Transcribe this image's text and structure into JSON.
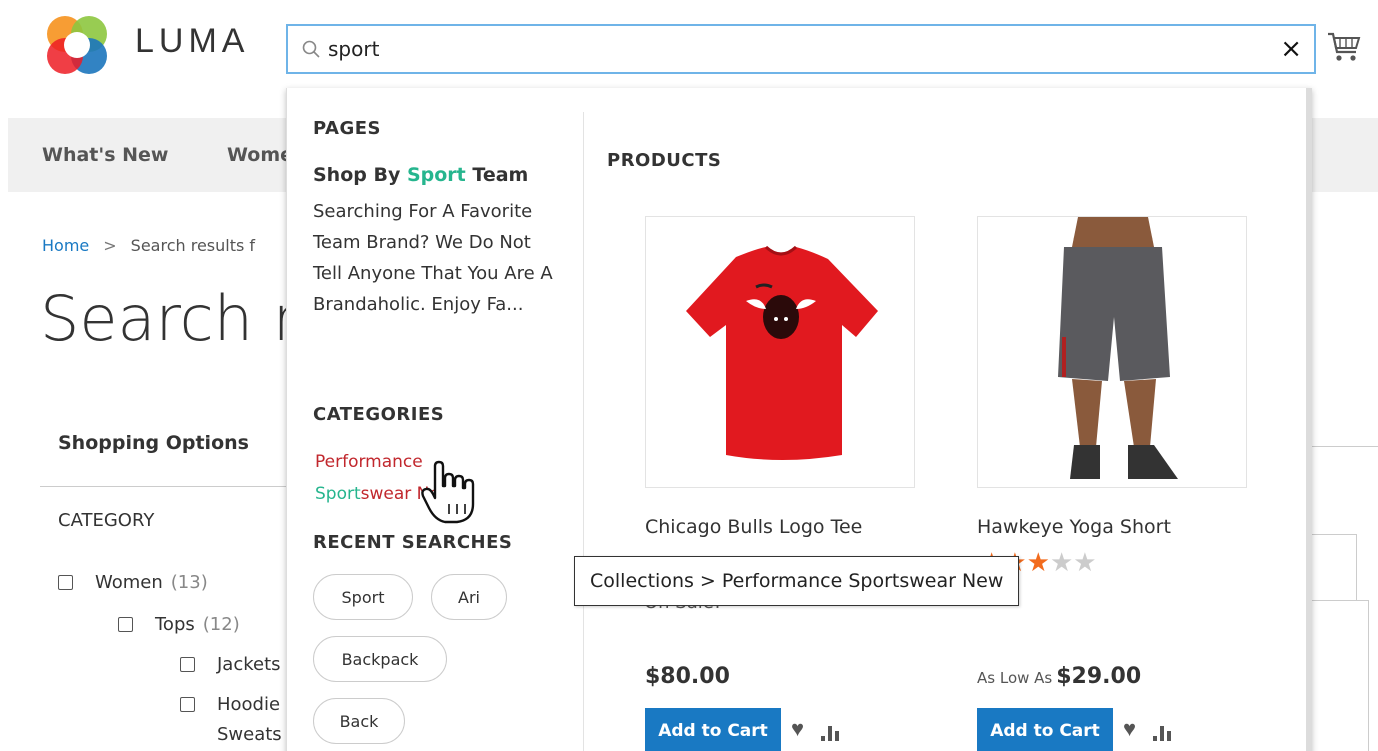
{
  "brand": {
    "name": "LUMA"
  },
  "search": {
    "query": "sport",
    "clear_icon": "×"
  },
  "nav": {
    "items": [
      "What's New",
      "Wome"
    ]
  },
  "breadcrumb": {
    "home": "Home",
    "separator": ">",
    "current": "Search results f"
  },
  "page_title": "Search re",
  "sidebar": {
    "shopping_options": "Shopping Options",
    "category_heading": "CATEGORY",
    "categories": [
      {
        "label": "Women",
        "count": "(13)"
      },
      {
        "label": "Tops",
        "count": "(12)"
      },
      {
        "label": "Jackets",
        "count": ""
      },
      {
        "label": "Hoodie",
        "count": ""
      },
      {
        "label": "Sweats",
        "count": ""
      }
    ]
  },
  "dropdown": {
    "pages_heading": "PAGES",
    "page_item": {
      "title_before": "Shop By ",
      "title_highlight": "Sport",
      "title_after": " Team",
      "description": "Searching For A Favorite Team Brand? We Do Not Tell Anyone That You Are A Brandaholic. Enjoy Fa..."
    },
    "categories_heading": "CATEGORIES",
    "category_item": {
      "line1": "Performance",
      "line2_highlight": "Sport",
      "line2_rest": "swear New"
    },
    "recent_heading": "RECENT SEARCHES",
    "recent": [
      "Sport",
      "Ari",
      "Backpack",
      "Back"
    ],
    "products_heading": "PRODUCTS",
    "products": [
      {
        "name": "Chicago Bulls Logo Tee",
        "price_prefix": "",
        "price": "$80.00",
        "badge": "On Sale!",
        "add_to_cart": "Add to Cart"
      },
      {
        "name": "Hawkeye Yoga Short",
        "price_prefix": "As Low As",
        "price": "$29.00",
        "rating": 3,
        "add_to_cart": "Add to Cart"
      }
    ]
  },
  "tooltip": "Collections > Performance Sportswear New",
  "colors": {
    "accent": "#1979c3",
    "highlight": "#26b58e",
    "category_link": "#c1272d",
    "search_border": "#6fb4e8"
  }
}
